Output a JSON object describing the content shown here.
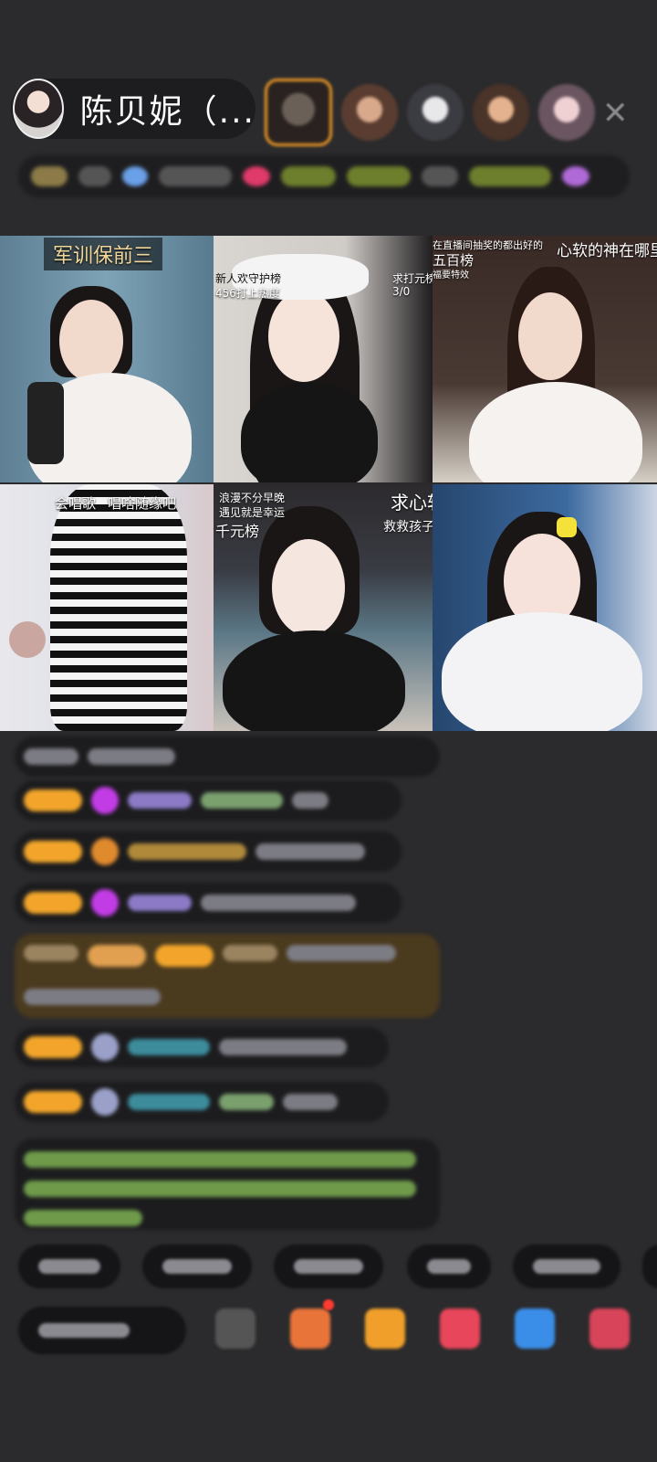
{
  "header": {
    "host_name": "陈贝妮（...",
    "close_icon": "close-icon"
  },
  "grid": {
    "tiles": [
      {
        "label": "军训保前三"
      },
      {
        "label_left": "新人欢守护榜",
        "label_left2": "456打上热度",
        "label_right": "求打元榜",
        "label_right2": "3/0"
      },
      {
        "label_top": "在直播间抽奖的都出好的",
        "label_mid": "五百榜",
        "label_sub": "福要特效",
        "label_right": "心软的神在哪里"
      },
      {
        "label_a": "会唱歌",
        "label_b": "唱啥随缘吧"
      },
      {
        "label_a": "浪漫不分早晚",
        "label_b": "遇见就是幸运",
        "label_c": "千元榜",
        "label_d": "求心软",
        "label_e": "救救孩子"
      },
      {
        "label": ""
      }
    ]
  },
  "colors": {
    "background": "#2b2b2d",
    "badge": "#f2a52a",
    "accent_orange": "#ee9a26"
  }
}
